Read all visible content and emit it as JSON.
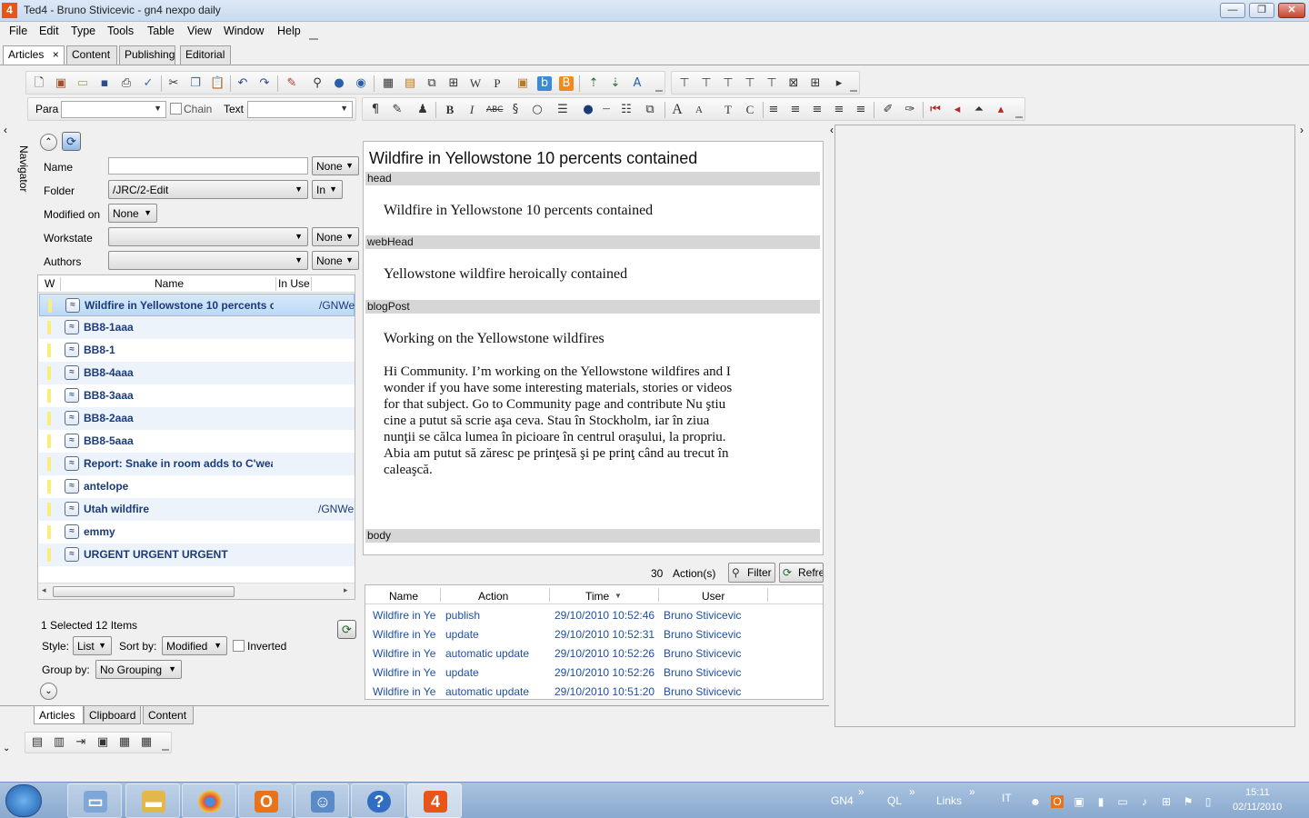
{
  "window": {
    "title": "Ted4 - Bruno Stivicevic - gn4 nexpo daily",
    "app_icon": "4",
    "min": "—",
    "max": "❐",
    "close": "✕"
  },
  "menu": [
    "File",
    "Edit",
    "Type",
    "Tools",
    "Table",
    "View",
    "Window",
    "Help"
  ],
  "top_tabs": [
    {
      "label": "Articles",
      "close": "×"
    },
    {
      "label": "Content"
    },
    {
      "label": "Publishing"
    },
    {
      "label": "Editorial"
    }
  ],
  "format_bar": {
    "para_label": "Para",
    "para_value": "",
    "chain_label": "Chain",
    "text_label": "Text",
    "text_value": ""
  },
  "navigator_label": "Navigator",
  "search": {
    "name_label": "Name",
    "name_value": "",
    "name_mode": "None",
    "folder_label": "Folder",
    "folder_value": "/JRC/2-Edit",
    "folder_mode": "In",
    "modified_label": "Modified on",
    "modified_value": "None",
    "workstate_label": "Workstate",
    "workstate_value": "",
    "workstate_mode": "None",
    "authors_label": "Authors",
    "authors_value": "",
    "authors_mode": "None"
  },
  "results": {
    "headers": {
      "w": "W",
      "name": "Name",
      "in_use": "In Use"
    },
    "rows": [
      {
        "name": "Wildfire in Yellowstone 10 percents c",
        "in_use": "/GNWe"
      },
      {
        "name": "BB8-1aaa",
        "in_use": ""
      },
      {
        "name": "BB8-1",
        "in_use": ""
      },
      {
        "name": "BB8-4aaa",
        "in_use": ""
      },
      {
        "name": "BB8-3aaa",
        "in_use": ""
      },
      {
        "name": "BB8-2aaa",
        "in_use": ""
      },
      {
        "name": "BB8-5aaa",
        "in_use": ""
      },
      {
        "name": "Report: Snake in room adds to C'wea",
        "in_use": ""
      },
      {
        "name": "antelope",
        "in_use": ""
      },
      {
        "name": "Utah wildfire",
        "in_use": "/GNWe"
      },
      {
        "name": "emmy",
        "in_use": ""
      },
      {
        "name": "URGENT URGENT URGENT",
        "in_use": ""
      }
    ],
    "status": "1 Selected 12 Items",
    "style_label": "Style:",
    "style_value": "List",
    "sort_label": "Sort by:",
    "sort_value": "Modified",
    "inverted_label": "Inverted",
    "group_label": "Group by:",
    "group_value": "No Grouping"
  },
  "bottom_tabs": [
    "Articles",
    "Clipboard",
    "Content"
  ],
  "editor": {
    "title": "Wildfire in Yellowstone 10 percents contained",
    "fields": [
      {
        "name": "head",
        "text": "Wildfire in Yellowstone 10 percents contained"
      },
      {
        "name": "webHead",
        "text": "Yellowstone wildfire heroically contained"
      },
      {
        "name": "blogPost",
        "text": "Working on the Yellowstone wildfires"
      },
      {
        "name": "body",
        "text": ""
      }
    ],
    "blog_body": [
      "Hi Community. I’m working on the Yellowstone wildfires and I",
      "wonder if you have some interesting materials, stories or videos",
      "for that subject. Go to Community page and contribute Nu ştiu",
      "cine a putut să scrie aşa ceva. Stau în Stockholm, iar în ziua",
      "nunţii se călca lumea în picioare în centrul oraşului, la propriu.",
      "Abia am putut să zăresc pe prinţesă şi pe prinţ când au trecut în",
      "caleaşcă."
    ]
  },
  "actions": {
    "count": "30",
    "count_label": "Action(s)",
    "filter_label": "Filter",
    "refresh_label": "Refre",
    "headers": {
      "name": "Name",
      "action": "Action",
      "time": "Time",
      "user": "User"
    },
    "rows": [
      {
        "name": "Wildfire in Ye",
        "action": "publish",
        "time": "29/10/2010 10:52:46",
        "user": "Bruno Stivicevic"
      },
      {
        "name": "Wildfire in Ye",
        "action": "update",
        "time": "29/10/2010 10:52:31",
        "user": "Bruno Stivicevic"
      },
      {
        "name": "Wildfire in Ye",
        "action": "automatic update",
        "time": "29/10/2010 10:52:26",
        "user": "Bruno Stivicevic"
      },
      {
        "name": "Wildfire in Ye",
        "action": "update",
        "time": "29/10/2010 10:52:26",
        "user": "Bruno Stivicevic"
      },
      {
        "name": "Wildfire in Ye",
        "action": "automatic update",
        "time": "29/10/2010 10:51:20",
        "user": "Bruno Stivicevic"
      }
    ]
  },
  "taskbar": {
    "toolbars": [
      "GN4",
      "QL",
      "Links"
    ],
    "chevron": "»",
    "lang": "IT",
    "clock_time": "15:11",
    "clock_date": "02/11/2010",
    "apps": [
      "start-orb",
      "pc",
      "explorer",
      "chrome",
      "outlook",
      "people",
      "help",
      "ted4"
    ]
  },
  "colors": {
    "accent": "#1a3b78",
    "link": "#1f4fa0",
    "app_orange": "#e8541a"
  }
}
